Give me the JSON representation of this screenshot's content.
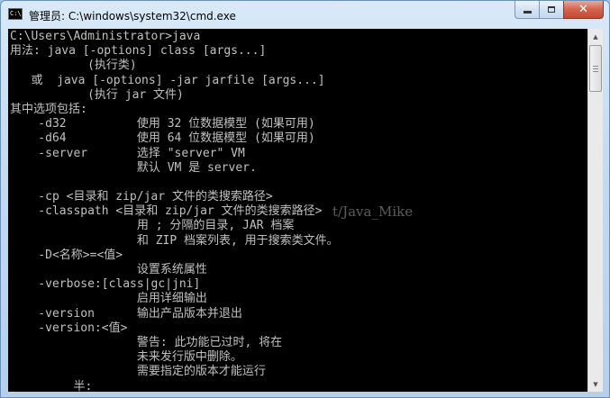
{
  "window": {
    "title": "管理员: C:\\windows\\system32\\cmd.exe",
    "icon_label": "C:\\",
    "icons": {
      "app": "console-app-icon",
      "minimize": "minimize-icon",
      "maximize": "maximize-icon",
      "close": "close-icon"
    },
    "close_glyph": "✕"
  },
  "console": {
    "lines": [
      "C:\\Users\\Administrator>java",
      "用法: java [-options] class [args...]",
      "           (执行类)",
      "   或  java [-options] -jar jarfile [args...]",
      "           (执行 jar 文件)",
      "其中选项包括:",
      "    -d32          使用 32 位数据模型 (如果可用)",
      "    -d64          使用 64 位数据模型 (如果可用)",
      "    -server       选择 \"server\" VM",
      "                  默认 VM 是 server.",
      "",
      "    -cp <目录和 zip/jar 文件的类搜索路径>",
      "    -classpath <目录和 zip/jar 文件的类搜索路径>",
      "                  用 ; 分隔的目录, JAR 档案",
      "                  和 ZIP 档案列表, 用于搜索类文件。",
      "    -D<名称>=<值>",
      "                  设置系统属性",
      "    -verbose:[class|gc|jni]",
      "                  启用详细输出",
      "    -version      输出产品版本并退出",
      "    -version:<值>",
      "                  警告: 此功能已过时, 将在",
      "                  未来发行版中删除。",
      "                  需要指定的版本才能运行",
      "         半:"
    ],
    "watermark": "t/Java_Mike"
  },
  "scrollbar": {
    "up_glyph": "▲",
    "down_glyph": "▼"
  }
}
